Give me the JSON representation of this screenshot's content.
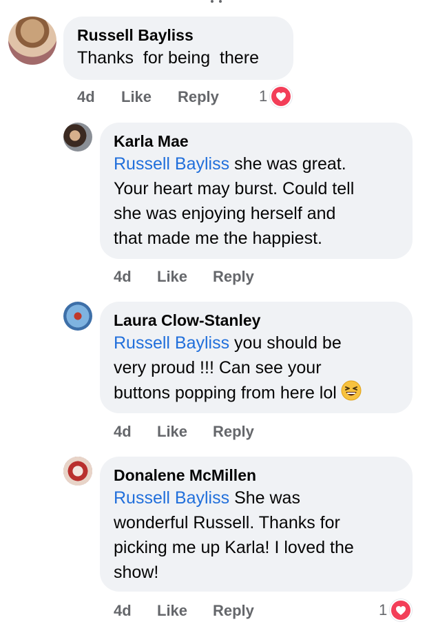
{
  "comments": [
    {
      "author": "Russell Bayliss",
      "text": "Thanks  for being  there",
      "time": "4d",
      "like": "Like",
      "reply": "Reply",
      "reaction_count": "1"
    },
    {
      "author": "Karla Mae",
      "mention": "Russell Bayliss",
      "lines": [
        "she was great.",
        "Your heart may burst. Could tell",
        "she was enjoying herself and",
        "that made me the happiest."
      ],
      "time": "4d",
      "like": "Like",
      "reply": "Reply"
    },
    {
      "author": "Laura Clow-Stanley",
      "mention": "Russell Bayliss",
      "lines": [
        " you should be",
        "very proud !!! Can see your",
        "buttons popping from here lol"
      ],
      "time": "4d",
      "like": "Like",
      "reply": "Reply"
    },
    {
      "author": "Donalene McMillen",
      "mention": "Russell Bayliss",
      "lines": [
        "She was",
        "wonderful Russell. Thanks for",
        "picking me up Karla! I loved the",
        "show!"
      ],
      "time": "4d",
      "like": "Like",
      "reply": "Reply",
      "reaction_count": "1"
    }
  ],
  "icons": {
    "reaction": "heart-icon",
    "laugh": "grinning-squinting-face-emoji"
  },
  "colors": {
    "bubble": "#f0f2f5",
    "mention": "#216fdb",
    "meta": "#65676b",
    "heart": "#f33e58"
  }
}
